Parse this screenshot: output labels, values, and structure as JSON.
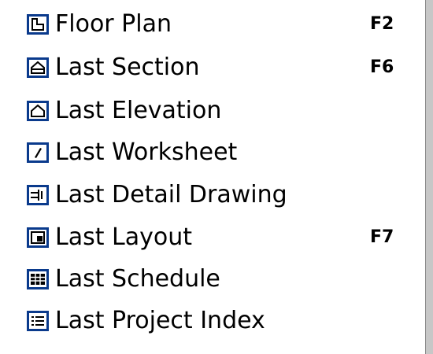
{
  "menu": {
    "items": [
      {
        "label": "Floor Plan",
        "shortcut": "F2",
        "icon": "floor-plan-icon"
      },
      {
        "label": "Last Section",
        "shortcut": "F6",
        "icon": "section-icon"
      },
      {
        "label": "Last Elevation",
        "shortcut": "",
        "icon": "elevation-icon"
      },
      {
        "label": "Last Worksheet",
        "shortcut": "",
        "icon": "worksheet-icon"
      },
      {
        "label": "Last Detail Drawing",
        "shortcut": "",
        "icon": "detail-drawing-icon"
      },
      {
        "label": "Last Layout",
        "shortcut": "F7",
        "icon": "layout-icon"
      },
      {
        "label": "Last Schedule",
        "shortcut": "",
        "icon": "schedule-icon"
      },
      {
        "label": "Last Project Index",
        "shortcut": "",
        "icon": "project-index-icon"
      }
    ]
  },
  "colors": {
    "icon_frame": "#0a3a8c",
    "icon_fill": "#ffffff",
    "text": "#000000"
  }
}
